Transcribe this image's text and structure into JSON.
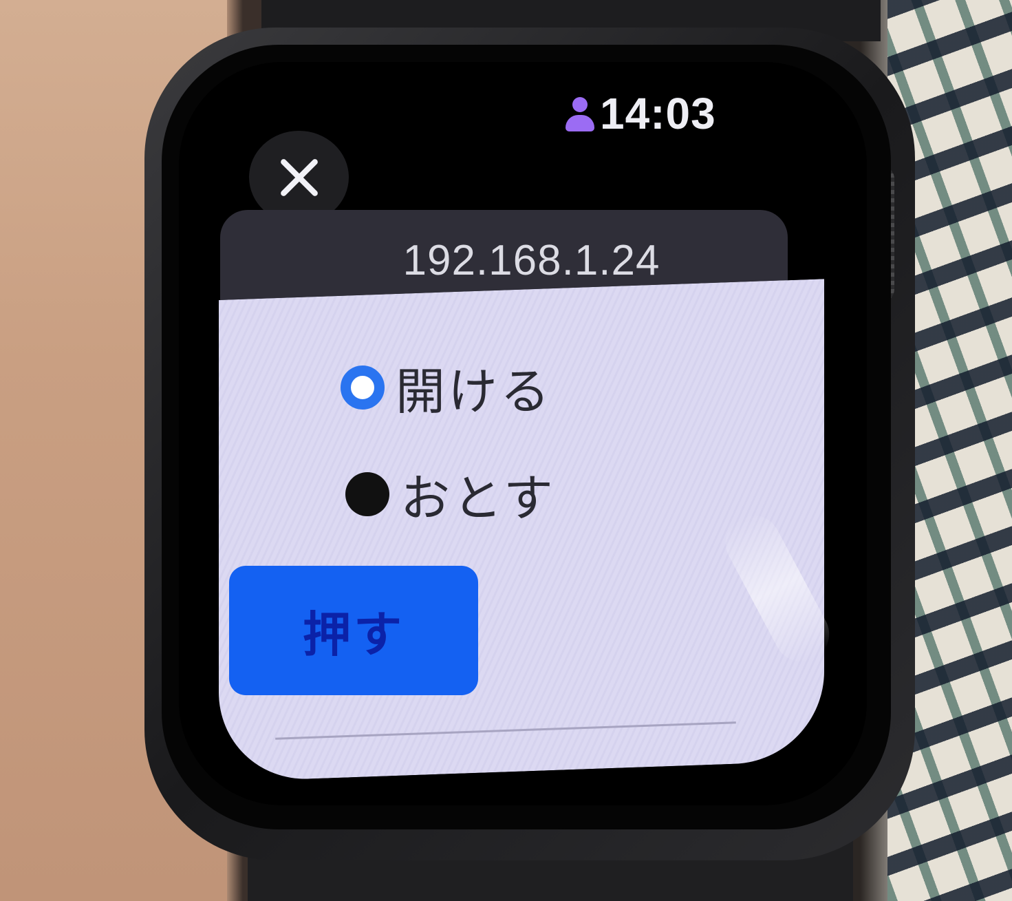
{
  "status_bar": {
    "time": "14:03",
    "user_icon": "person-icon"
  },
  "toolbar": {
    "close_icon": "close-icon"
  },
  "address": {
    "url": "192.168.1.24"
  },
  "form": {
    "options": [
      {
        "label": "開ける",
        "selected": true
      },
      {
        "label": "おとす",
        "selected": false
      }
    ],
    "submit_label": "押す"
  },
  "colors": {
    "accent": "#1461f2",
    "radio_selected": "#2a74f0",
    "page_background": "#dcd9f2",
    "user_icon": "#9b6cf3"
  }
}
